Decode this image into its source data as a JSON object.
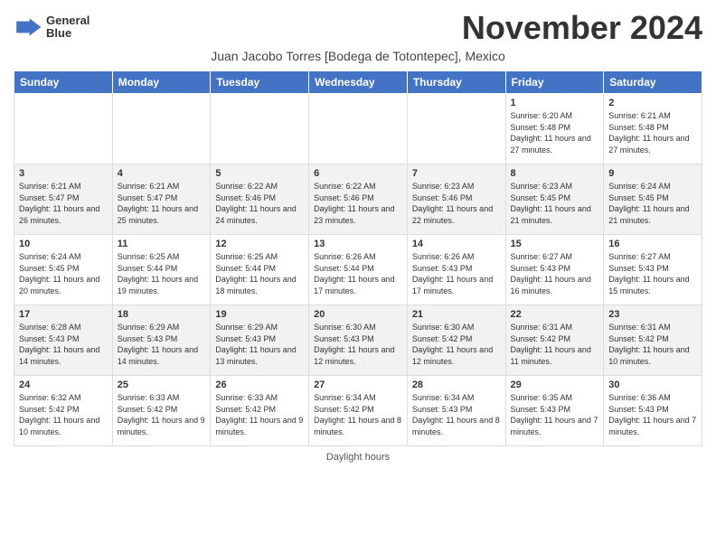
{
  "header": {
    "logo_line1": "General",
    "logo_line2": "Blue",
    "month": "November 2024",
    "subtitle": "Juan Jacobo Torres [Bodega de Totontepec], Mexico"
  },
  "days_of_week": [
    "Sunday",
    "Monday",
    "Tuesday",
    "Wednesday",
    "Thursday",
    "Friday",
    "Saturday"
  ],
  "weeks": [
    [
      {
        "day": "",
        "info": ""
      },
      {
        "day": "",
        "info": ""
      },
      {
        "day": "",
        "info": ""
      },
      {
        "day": "",
        "info": ""
      },
      {
        "day": "",
        "info": ""
      },
      {
        "day": "1",
        "info": "Sunrise: 6:20 AM\nSunset: 5:48 PM\nDaylight: 11 hours and 27 minutes."
      },
      {
        "day": "2",
        "info": "Sunrise: 6:21 AM\nSunset: 5:48 PM\nDaylight: 11 hours and 27 minutes."
      }
    ],
    [
      {
        "day": "3",
        "info": "Sunrise: 6:21 AM\nSunset: 5:47 PM\nDaylight: 11 hours and 26 minutes."
      },
      {
        "day": "4",
        "info": "Sunrise: 6:21 AM\nSunset: 5:47 PM\nDaylight: 11 hours and 25 minutes."
      },
      {
        "day": "5",
        "info": "Sunrise: 6:22 AM\nSunset: 5:46 PM\nDaylight: 11 hours and 24 minutes."
      },
      {
        "day": "6",
        "info": "Sunrise: 6:22 AM\nSunset: 5:46 PM\nDaylight: 11 hours and 23 minutes."
      },
      {
        "day": "7",
        "info": "Sunrise: 6:23 AM\nSunset: 5:46 PM\nDaylight: 11 hours and 22 minutes."
      },
      {
        "day": "8",
        "info": "Sunrise: 6:23 AM\nSunset: 5:45 PM\nDaylight: 11 hours and 21 minutes."
      },
      {
        "day": "9",
        "info": "Sunrise: 6:24 AM\nSunset: 5:45 PM\nDaylight: 11 hours and 21 minutes."
      }
    ],
    [
      {
        "day": "10",
        "info": "Sunrise: 6:24 AM\nSunset: 5:45 PM\nDaylight: 11 hours and 20 minutes."
      },
      {
        "day": "11",
        "info": "Sunrise: 6:25 AM\nSunset: 5:44 PM\nDaylight: 11 hours and 19 minutes."
      },
      {
        "day": "12",
        "info": "Sunrise: 6:25 AM\nSunset: 5:44 PM\nDaylight: 11 hours and 18 minutes."
      },
      {
        "day": "13",
        "info": "Sunrise: 6:26 AM\nSunset: 5:44 PM\nDaylight: 11 hours and 17 minutes."
      },
      {
        "day": "14",
        "info": "Sunrise: 6:26 AM\nSunset: 5:43 PM\nDaylight: 11 hours and 17 minutes."
      },
      {
        "day": "15",
        "info": "Sunrise: 6:27 AM\nSunset: 5:43 PM\nDaylight: 11 hours and 16 minutes."
      },
      {
        "day": "16",
        "info": "Sunrise: 6:27 AM\nSunset: 5:43 PM\nDaylight: 11 hours and 15 minutes."
      }
    ],
    [
      {
        "day": "17",
        "info": "Sunrise: 6:28 AM\nSunset: 5:43 PM\nDaylight: 11 hours and 14 minutes."
      },
      {
        "day": "18",
        "info": "Sunrise: 6:29 AM\nSunset: 5:43 PM\nDaylight: 11 hours and 14 minutes."
      },
      {
        "day": "19",
        "info": "Sunrise: 6:29 AM\nSunset: 5:43 PM\nDaylight: 11 hours and 13 minutes."
      },
      {
        "day": "20",
        "info": "Sunrise: 6:30 AM\nSunset: 5:43 PM\nDaylight: 11 hours and 12 minutes."
      },
      {
        "day": "21",
        "info": "Sunrise: 6:30 AM\nSunset: 5:42 PM\nDaylight: 11 hours and 12 minutes."
      },
      {
        "day": "22",
        "info": "Sunrise: 6:31 AM\nSunset: 5:42 PM\nDaylight: 11 hours and 11 minutes."
      },
      {
        "day": "23",
        "info": "Sunrise: 6:31 AM\nSunset: 5:42 PM\nDaylight: 11 hours and 10 minutes."
      }
    ],
    [
      {
        "day": "24",
        "info": "Sunrise: 6:32 AM\nSunset: 5:42 PM\nDaylight: 11 hours and 10 minutes."
      },
      {
        "day": "25",
        "info": "Sunrise: 6:33 AM\nSunset: 5:42 PM\nDaylight: 11 hours and 9 minutes."
      },
      {
        "day": "26",
        "info": "Sunrise: 6:33 AM\nSunset: 5:42 PM\nDaylight: 11 hours and 9 minutes."
      },
      {
        "day": "27",
        "info": "Sunrise: 6:34 AM\nSunset: 5:42 PM\nDaylight: 11 hours and 8 minutes."
      },
      {
        "day": "28",
        "info": "Sunrise: 6:34 AM\nSunset: 5:43 PM\nDaylight: 11 hours and 8 minutes."
      },
      {
        "day": "29",
        "info": "Sunrise: 6:35 AM\nSunset: 5:43 PM\nDaylight: 11 hours and 7 minutes."
      },
      {
        "day": "30",
        "info": "Sunrise: 6:36 AM\nSunset: 5:43 PM\nDaylight: 11 hours and 7 minutes."
      }
    ]
  ],
  "footer": "Daylight hours"
}
